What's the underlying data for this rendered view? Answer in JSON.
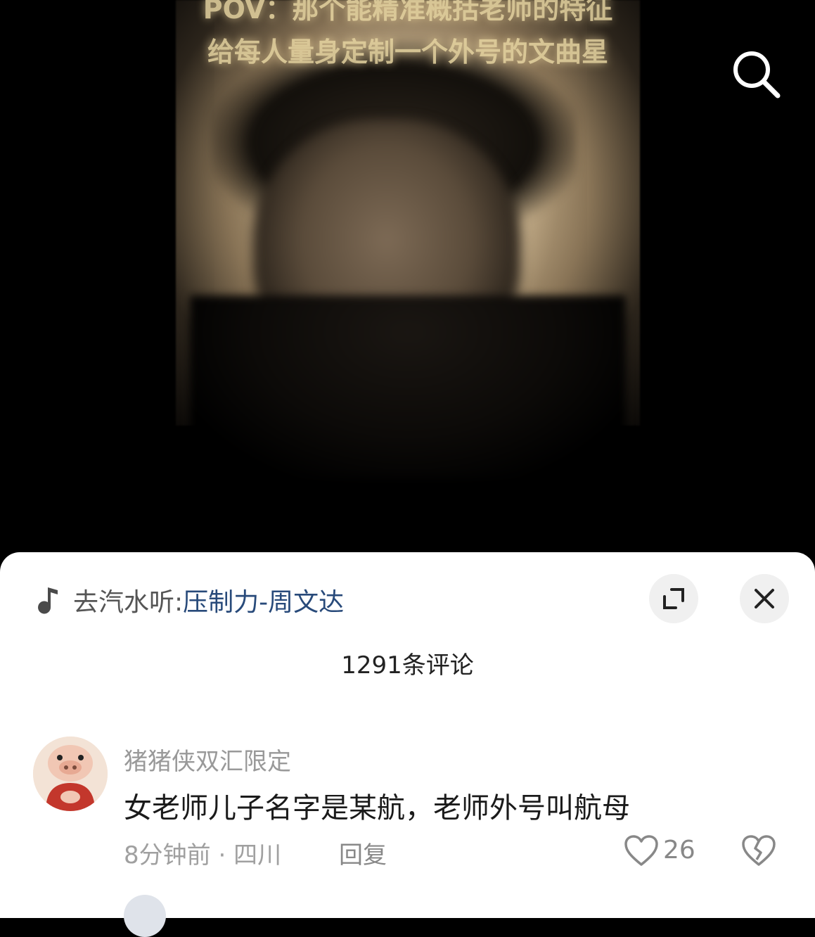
{
  "video": {
    "caption_line1": "POV：那个能精准概括老师的特征",
    "caption_line2": "给每人量身定制一个外号的文曲星"
  },
  "icons": {
    "search": "search-icon",
    "music": "music-note-icon",
    "expand": "expand-icon",
    "close": "close-icon",
    "like": "heart-outline-icon",
    "dislike": "broken-heart-icon"
  },
  "music": {
    "prefix": "去汽水听: ",
    "song": "压制力-周文达"
  },
  "comments": {
    "count_label": "1291条评论",
    "items": [
      {
        "username": "猪猪侠双汇限定",
        "text": "女老师儿子名字是某航，老师外号叫航母",
        "time": "8分钟前",
        "separator": " · ",
        "location": "四川",
        "reply_label": "回复",
        "likes": "26"
      }
    ]
  },
  "colors": {
    "song_link": "#284a7a",
    "secondary_text": "#999999",
    "caption": "#e8d6a2"
  }
}
